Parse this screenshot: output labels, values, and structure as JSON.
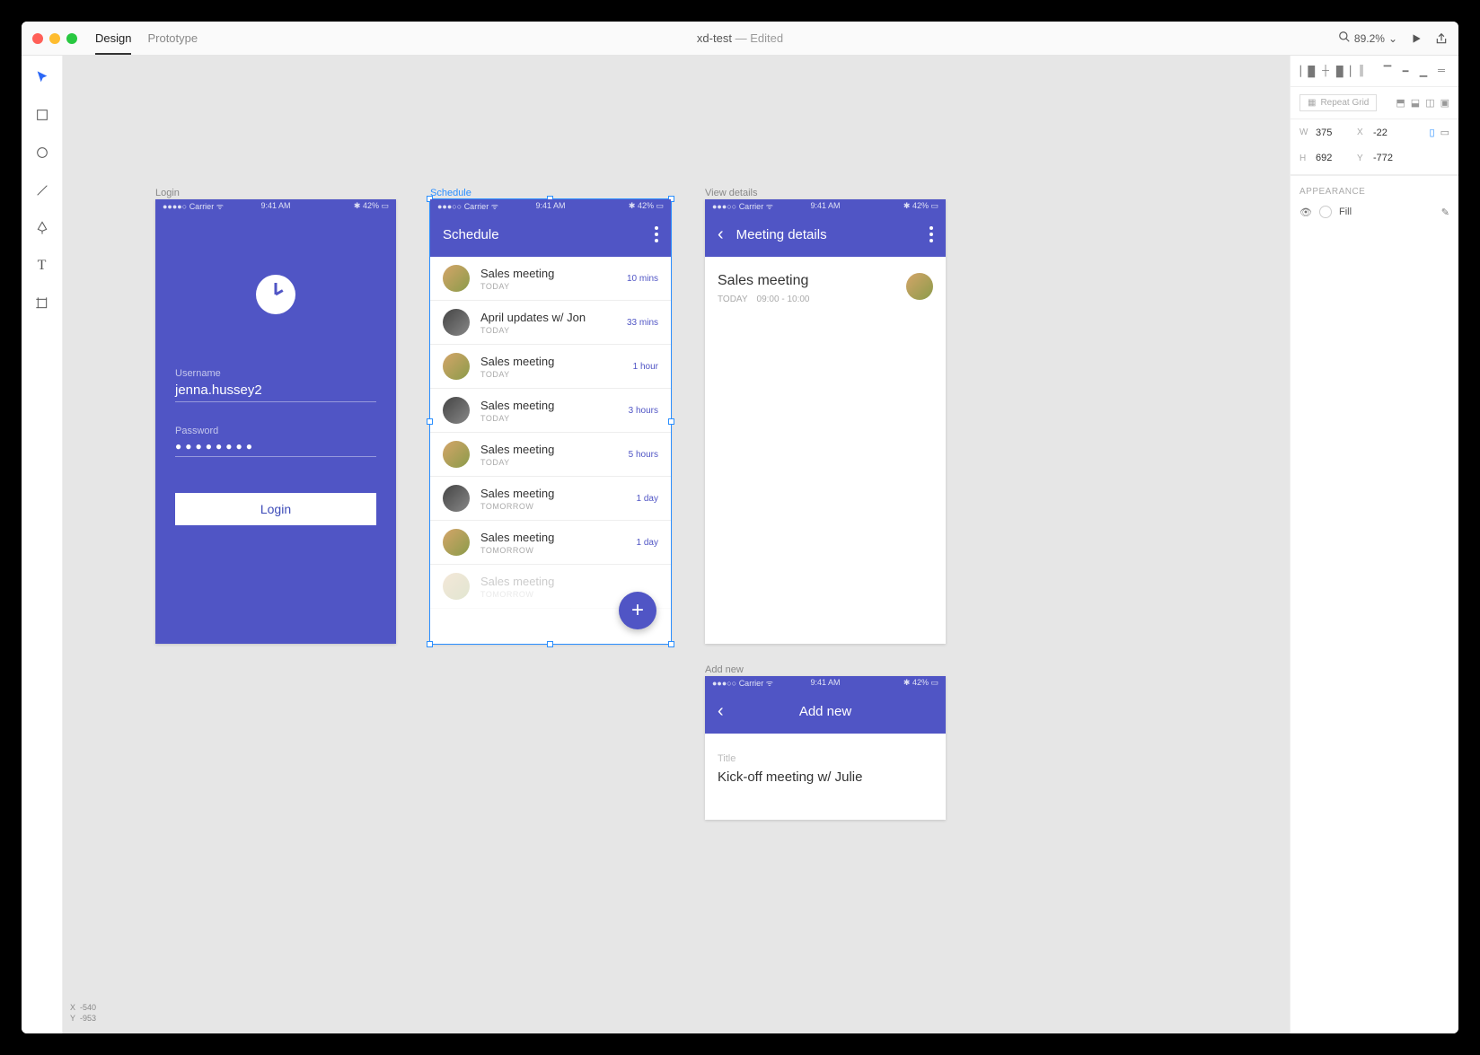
{
  "titlebar": {
    "modes": {
      "design": "Design",
      "prototype": "Prototype"
    },
    "doc": "xd-test",
    "status": "Edited",
    "zoom": "89.2%"
  },
  "canvas": {
    "coords": {
      "x_label": "X",
      "x": "-540",
      "y_label": "Y",
      "y": "-953"
    }
  },
  "artboards": {
    "login": {
      "label": "Login",
      "status": {
        "carrier": "Carrier",
        "wifi": "",
        "time": "9:41 AM",
        "batt": "42%"
      },
      "username_label": "Username",
      "username_value": "jenna.hussey2",
      "password_label": "Password",
      "password_value": "●●●●●●●●",
      "login_btn": "Login"
    },
    "schedule": {
      "label": "Schedule",
      "status": {
        "carrier": "Carrier",
        "time": "9:41 AM",
        "batt": "42%"
      },
      "title": "Schedule",
      "rows": [
        {
          "title": "Sales meeting",
          "sub": "TODAY",
          "time": "10 mins",
          "av": "av1"
        },
        {
          "title": "April updates w/ Jon",
          "sub": "TODAY",
          "time": "33 mins",
          "av": "av2"
        },
        {
          "title": "Sales meeting",
          "sub": "TODAY",
          "time": "1 hour",
          "av": "av1"
        },
        {
          "title": "Sales meeting",
          "sub": "TODAY",
          "time": "3 hours",
          "av": "av2"
        },
        {
          "title": "Sales meeting",
          "sub": "TODAY",
          "time": "5 hours",
          "av": "av1"
        },
        {
          "title": "Sales meeting",
          "sub": "TOMORROW",
          "time": "1 day",
          "av": "av2"
        },
        {
          "title": "Sales meeting",
          "sub": "TOMORROW",
          "time": "1 day",
          "av": "av1"
        },
        {
          "title": "Sales meeting",
          "sub": "TOMORROW",
          "time": "",
          "av": "av1",
          "faded": true
        }
      ]
    },
    "details": {
      "label": "View details",
      "status": {
        "carrier": "Carrier",
        "time": "9:41 AM",
        "batt": "42%"
      },
      "title": "Meeting details",
      "body_title": "Sales meeting",
      "body_sub1": "TODAY",
      "body_sub2": "09:00 - 10:00"
    },
    "addnew": {
      "label": "Add new",
      "status": {
        "carrier": "Carrier",
        "time": "9:41 AM",
        "batt": "42%"
      },
      "title": "Add new",
      "field_label": "Title",
      "field_value": "Kick-off meeting w/ Julie"
    }
  },
  "inspector": {
    "repeat_grid": "Repeat Grid",
    "w_label": "W",
    "w": "375",
    "x_label": "X",
    "x": "-22",
    "h_label": "H",
    "h": "692",
    "y_label": "Y",
    "y": "-772",
    "appearance": "APPEARANCE",
    "fill": "Fill"
  }
}
